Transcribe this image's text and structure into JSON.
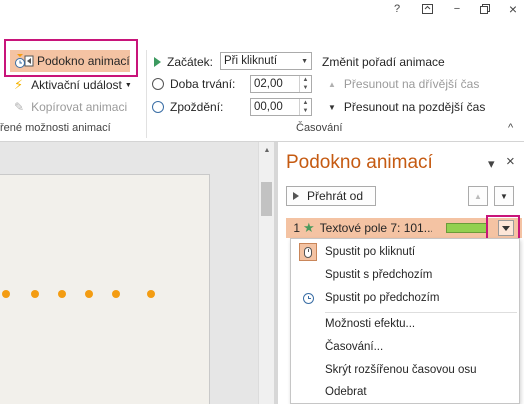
{
  "window": {
    "help_icon": "?",
    "ribbon_display_icon": "ribbon-display-icon",
    "minimize_icon": "−",
    "restore_icon": "restore-icon",
    "close_icon": "×"
  },
  "ribbon": {
    "advanced_group": {
      "animation_pane_label": "Podokno animací",
      "trigger_label": "Aktivační událost",
      "copy_animation_label": "Kopírovat animaci",
      "group_label": "řené možnosti animací"
    },
    "timing_group": {
      "start_label": "Začátek:",
      "start_value": "Při kliknutí",
      "duration_label": "Doba trvání:",
      "duration_value": "02,00",
      "delay_label": "Zpoždění:",
      "delay_value": "00,00",
      "reorder_label": "Změnit pořadí animace",
      "move_earlier_label": "Přesunout na dřívější čas",
      "move_later_label": "Přesunout na pozdější čas",
      "group_label": "Časování",
      "collapse_icon": "^"
    }
  },
  "pane": {
    "title": "Podokno animací",
    "options_icon": "▾",
    "close_icon": "×",
    "play_label": "Přehrát od",
    "item": {
      "number": "1",
      "star_icon": "★",
      "name": "Textové pole 7: 101..."
    }
  },
  "context_menu": {
    "items": [
      {
        "label": "Spustit po kliknutí",
        "icon": "mouse-icon"
      },
      {
        "label": "Spustit s předchozím",
        "icon": ""
      },
      {
        "label": "Spustit po předchozím",
        "icon": "clock-icon"
      },
      {
        "label": "Možnosti efektu...",
        "icon": ""
      },
      {
        "label": "Časování...",
        "icon": ""
      },
      {
        "label": "Skrýt rozšířenou časovou osu",
        "icon": ""
      },
      {
        "label": "Odebrat",
        "icon": ""
      }
    ]
  },
  "colors": {
    "pane_title": "#c55a11",
    "selected_row": "#f4c3a3",
    "timing_bar": "#92d050",
    "highlight_box": "#c8147a",
    "slide_dots": "#f39c12"
  }
}
